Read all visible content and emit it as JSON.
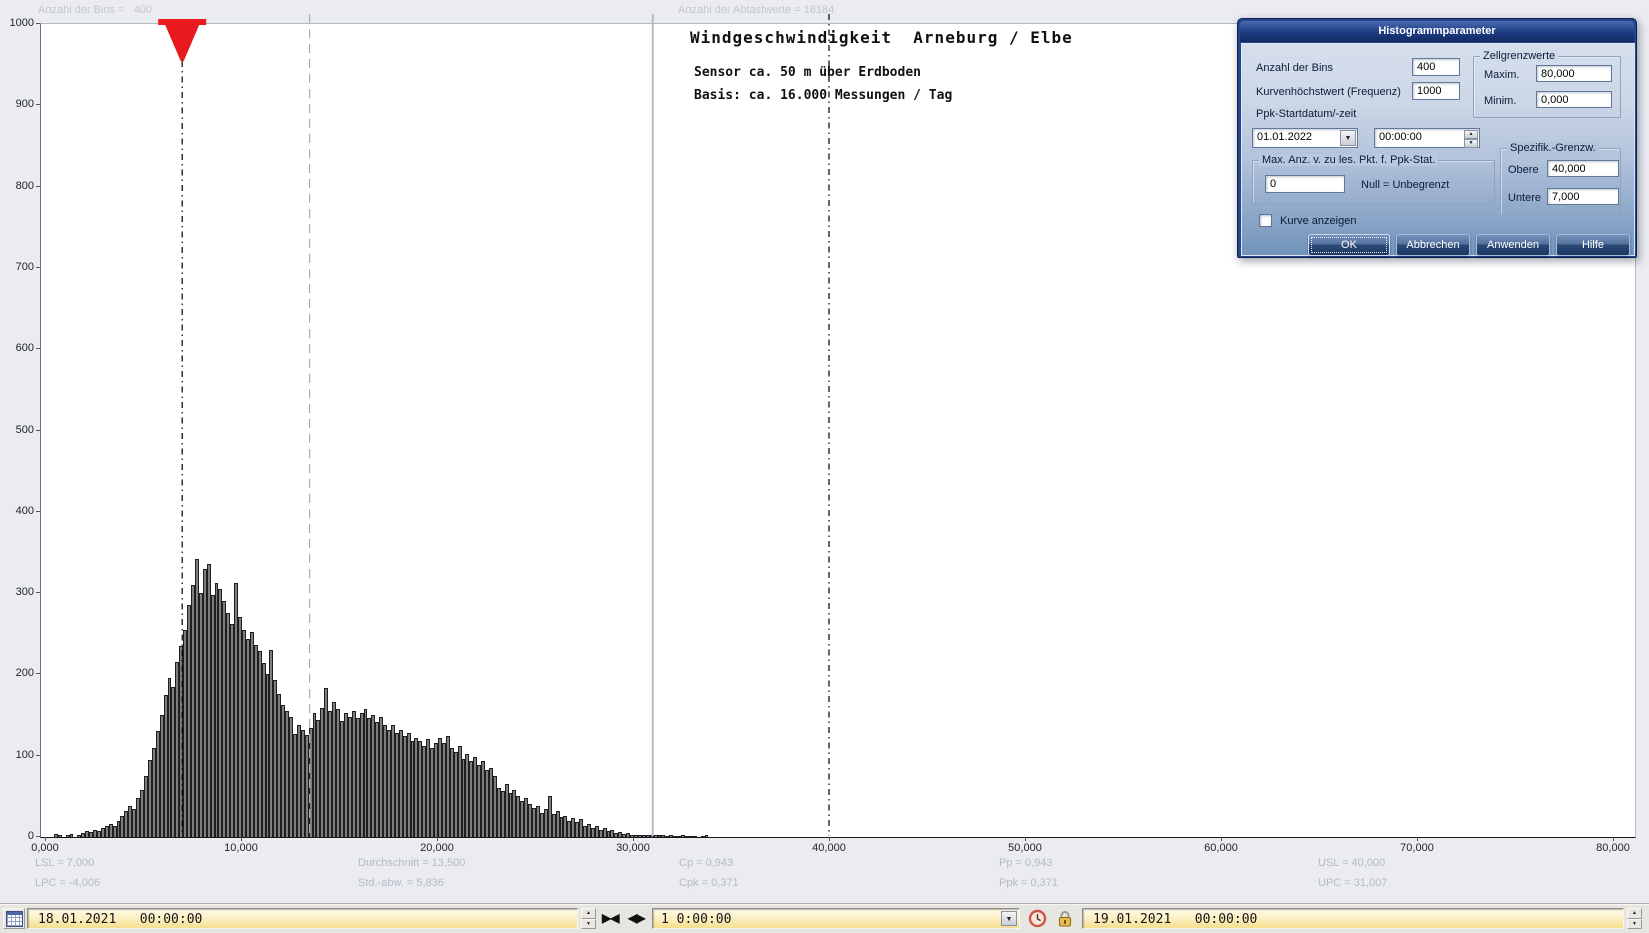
{
  "chart": {
    "top_left_note": "Anzahl der Bins =   400",
    "top_center_note": "Anzahl der Abtastwerte = 16184",
    "title": "Windgeschwindigkeit  Arneburg / Elbe",
    "subtitle_line1": "Sensor ca. 50 m über Erdboden",
    "subtitle_line2": "Basis: ca. 16.000 Messungen / Tag"
  },
  "chart_data": {
    "type": "bar",
    "histogram": true,
    "title": "Windgeschwindigkeit  Arneburg / Elbe",
    "xlabel": "",
    "ylabel": "",
    "bin_width": 200,
    "x_start": 0,
    "xlim": [
      0,
      81300
    ],
    "ylim": [
      0,
      1000
    ],
    "x_tick_values": [
      0,
      10000,
      20000,
      30000,
      40000,
      50000,
      60000,
      70000,
      80000
    ],
    "x_tick_labels": [
      "0,000",
      "10,000",
      "20,000",
      "30,000",
      "40,000",
      "50,000",
      "60,000",
      "70,000",
      "80,000"
    ],
    "y_tick_values": [
      0,
      100,
      200,
      300,
      400,
      500,
      600,
      700,
      800,
      900,
      1000
    ],
    "bar_color": "#7e7e7e",
    "bar_border_color": "#1f1f1f",
    "grid": false,
    "ref_lines": [
      {
        "name": "LSL",
        "value": 7000,
        "style": "dashdot",
        "color": "#000000",
        "marker": "red-arrow",
        "marker_color": "#e8191f"
      },
      {
        "name": "Durchschnitt",
        "value": 13500,
        "style": "dash",
        "color": "#a9aeb6"
      },
      {
        "name": "UPC",
        "value": 31007,
        "style": "solid",
        "color": "#b8bcc2"
      },
      {
        "name": "USL",
        "value": 40000,
        "style": "dashdot",
        "color": "#000000"
      }
    ],
    "bin_heights": [
      0,
      0,
      4,
      2,
      0,
      3,
      4,
      0,
      2,
      5,
      7,
      6,
      9,
      7,
      11,
      13,
      16,
      14,
      20,
      26,
      32,
      38,
      35,
      48,
      58,
      75,
      95,
      110,
      130,
      150,
      175,
      195,
      185,
      215,
      235,
      255,
      285,
      310,
      342,
      300,
      330,
      336,
      298,
      312,
      305,
      290,
      276,
      262,
      313,
      270,
      255,
      244,
      252,
      236,
      229,
      214,
      200,
      230,
      193,
      176,
      162,
      155,
      148,
      127,
      138,
      131,
      125,
      134,
      152,
      144,
      159,
      183,
      155,
      166,
      158,
      143,
      152,
      147,
      155,
      146,
      152,
      158,
      146,
      150,
      141,
      147,
      138,
      132,
      138,
      128,
      131,
      124,
      128,
      118,
      122,
      118,
      112,
      120,
      110,
      116,
      122,
      116,
      124,
      110,
      105,
      112,
      96,
      102,
      93,
      98,
      88,
      93,
      83,
      85,
      75,
      60,
      56,
      65,
      54,
      58,
      50,
      44,
      48,
      40,
      36,
      38,
      30,
      34,
      50,
      28,
      32,
      24,
      26,
      20,
      23,
      18,
      22,
      14,
      16,
      11,
      13,
      9,
      11,
      7,
      8,
      5,
      6,
      4,
      5,
      3,
      3,
      2,
      3,
      2,
      2,
      2,
      3,
      2,
      1,
      2,
      1,
      1,
      2,
      1,
      1,
      1,
      0,
      1,
      2,
      0
    ]
  },
  "stats": {
    "row1": [
      "LSL = 7,000",
      "Durchschnitt = 13,500",
      "Cp = 0,943",
      "Pp = 0,943",
      "USL = 40,000"
    ],
    "row2": [
      "LPC = -4,006",
      "Std.-abw. = 5,836",
      "Cpk = 0,371",
      "Ppk = 0,371",
      "UPC = 31,007"
    ]
  },
  "dialog": {
    "title": "Histogrammparameter",
    "fields": {
      "anzahl_bins_label": "Anzahl der Bins",
      "anzahl_bins_value": "400",
      "kurvenhoechstwert_label": "Kurvenhöchstwert (Frequenz)",
      "kurvenhoechstwert_value": "1000",
      "ppk_startdatum_label": "Ppk-Startdatum/-zeit",
      "date_value": "01.01.2022",
      "time_value": "00:00:00",
      "zellgrenzwerte_label": "Zellgrenzwerte",
      "maxim_label": "Maxim.",
      "maxim_value": "80,000",
      "minim_label": "Minim.",
      "minim_value": "0,000",
      "max_anz_label": "Max. Anz. v. zu les. Pkt. f. Ppk-Stat.",
      "max_anz_value": "0",
      "null_unbegrenzt_label": "Null = Unbegrenzt",
      "spezifik_label": "Spezifik.-Grenzw.",
      "obere_label": "Obere",
      "obere_value": "40,000",
      "untere_label": "Untere",
      "untere_value": "7,000",
      "kurve_anzeigen_label": "Kurve anzeigen"
    },
    "buttons": {
      "ok": "OK",
      "abbrechen": "Abbrechen",
      "anwenden": "Anwenden",
      "hilfe": "Hilfe"
    }
  },
  "toolbar": {
    "start_datetime": "18.01.2021   00:00:00",
    "interval_value": "1 0:00:00",
    "end_datetime": "19.01.2021   00:00:00"
  },
  "icons": {
    "collapse_arrows": "▶◀",
    "expand_arrows": "◀▶",
    "dropdown": "▼",
    "spin_up": "▲",
    "spin_down": "▼"
  }
}
